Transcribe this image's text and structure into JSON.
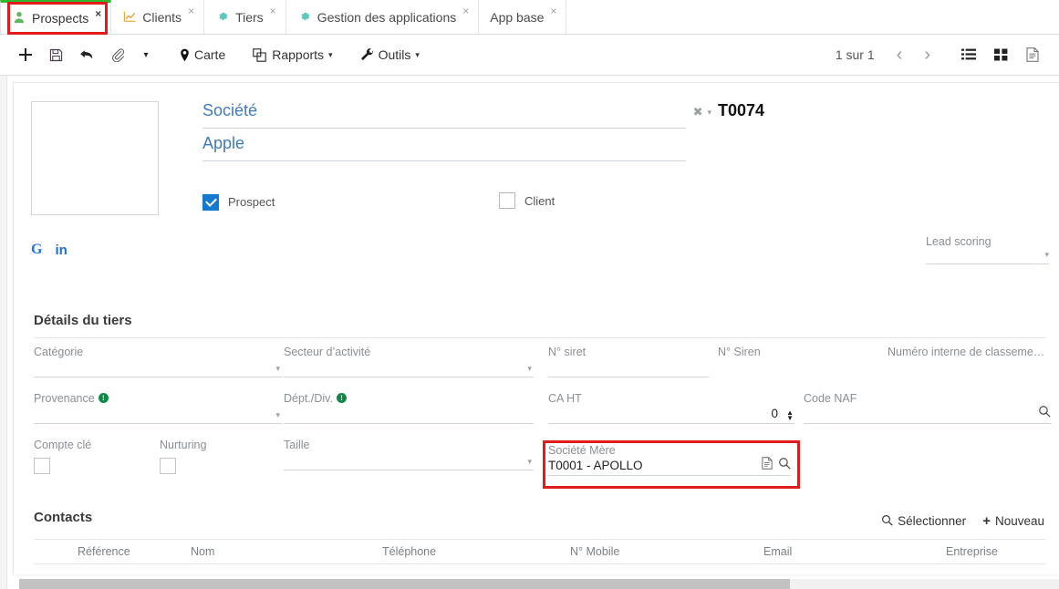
{
  "tabs": [
    {
      "label": "Prospects",
      "icon": "user-icon",
      "icon_color": "#5cb85c",
      "active": true,
      "close": "×"
    },
    {
      "label": "Clients",
      "icon": "chart-line-icon",
      "icon_color": "#e8a33d",
      "active": false,
      "close": "×"
    },
    {
      "label": "Tiers",
      "icon": "gear-icon",
      "icon_color": "#5bc8c0",
      "active": false,
      "close": "×"
    },
    {
      "label": "Gestion des applications",
      "icon": "gear-icon",
      "icon_color": "#5bc8c0",
      "active": false,
      "close": "×"
    },
    {
      "label": "App base",
      "icon": "none",
      "icon_color": "#888888",
      "active": false,
      "close": "×"
    }
  ],
  "toolbar": {
    "add_label": "",
    "save_label": "",
    "undo_label": "",
    "attach_label": "",
    "more_caret": "▾",
    "carte_label": "Carte",
    "rapports_label": "Rapports",
    "rapports_caret": "▾",
    "outils_label": "Outils",
    "outils_caret": "▾",
    "pager_text": "1 sur 1",
    "prev_arrow": "‹",
    "next_arrow": "›"
  },
  "record": {
    "societe_label": "Société",
    "societe_value": "Apple",
    "clear_icon": "✖",
    "dropdown_icon": "▾",
    "code": "T0074",
    "prospect_label": "Prospect",
    "prospect_checked": true,
    "client_label": "Client",
    "client_checked": false,
    "google_icon": "G",
    "linkedin_icon": "in",
    "lead_scoring_label": "Lead scoring",
    "lead_scoring_value": "",
    "lead_scoring_caret": "▾"
  },
  "details": {
    "section_title": "Détails du tiers",
    "fields": {
      "categorie": {
        "label": "Catégorie",
        "value": "",
        "caret": "▾"
      },
      "secteur": {
        "label": "Secteur d’activité",
        "value": "",
        "caret": "▾"
      },
      "siret": {
        "label": "N° siret",
        "value": ""
      },
      "siren": {
        "label": "N° Siren",
        "value": ""
      },
      "numero_interne": {
        "label": "Numéro interne de classeme…",
        "value": ""
      },
      "provenance": {
        "label": "Provenance",
        "info": "!",
        "value": "",
        "caret": "▾"
      },
      "dept_div": {
        "label": "Dépt./Div.",
        "info": "!",
        "value": ""
      },
      "ca_ht": {
        "label": "CA HT",
        "value": "0",
        "spin_up": "▲",
        "spin_down": "▼"
      },
      "code_naf": {
        "label": "Code NAF",
        "value": "",
        "search_icon": "search-icon"
      },
      "compte_cle": {
        "label": "Compte clé",
        "checked": false
      },
      "nurturing": {
        "label": "Nurturing",
        "checked": false
      },
      "taille": {
        "label": "Taille",
        "value": "",
        "caret": "▾"
      },
      "societe_mere": {
        "label": "Société Mère",
        "value": "T0001 - APOLLO",
        "doc_icon": "document-icon",
        "search_icon": "search-icon"
      }
    }
  },
  "contacts": {
    "section_title": "Contacts",
    "select_label": "Sélectionner",
    "new_label": "Nouveau",
    "new_plus": "+",
    "columns": [
      "Référence",
      "Nom",
      "Téléphone",
      "N° Mobile",
      "Email",
      "Entreprise"
    ],
    "rows": []
  },
  "colors": {
    "highlight": "#e01b1b",
    "accent_blue": "#3f7bbf",
    "active_tab_bar": "#2eb82e",
    "checkbox_on": "#1579d0",
    "info_green": "#0f8a46"
  }
}
